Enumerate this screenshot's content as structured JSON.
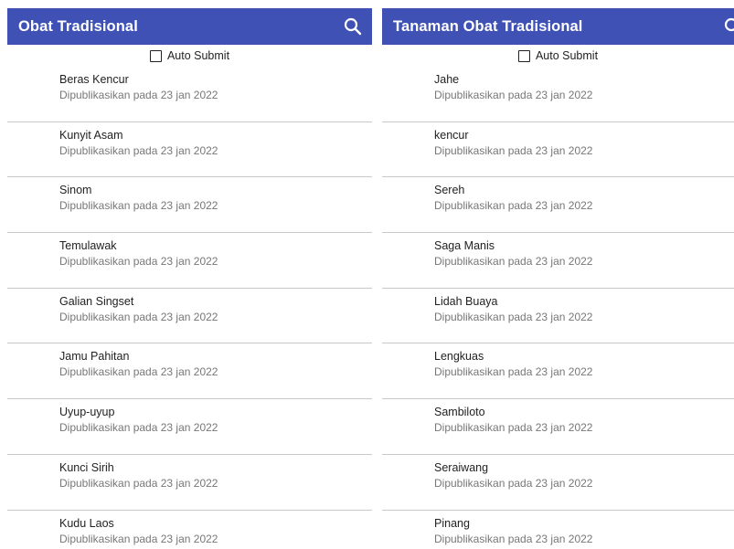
{
  "left": {
    "title": "Obat Tradisional",
    "checkbox_label": "Auto Submit",
    "items": [
      {
        "name": "Beras Kencur",
        "subtitle": "Dipublikasikan pada 23 jan 2022"
      },
      {
        "name": "Kunyit Asam",
        "subtitle": "Dipublikasikan pada 23 jan 2022"
      },
      {
        "name": "Sinom",
        "subtitle": "Dipublikasikan pada 23 jan 2022"
      },
      {
        "name": "Temulawak",
        "subtitle": "Dipublikasikan pada 23 jan 2022"
      },
      {
        "name": "Galian Singset",
        "subtitle": "Dipublikasikan pada 23 jan 2022"
      },
      {
        "name": "Jamu Pahitan",
        "subtitle": "Dipublikasikan pada 23 jan 2022"
      },
      {
        "name": "Uyup-uyup",
        "subtitle": "Dipublikasikan pada 23 jan 2022"
      },
      {
        "name": "Kunci Sirih",
        "subtitle": "Dipublikasikan pada 23 jan 2022"
      },
      {
        "name": "Kudu Laos",
        "subtitle": "Dipublikasikan pada 23 jan 2022"
      }
    ]
  },
  "right": {
    "title": "Tanaman Obat Tradisional",
    "checkbox_label": "Auto Submit",
    "items": [
      {
        "name": "Jahe",
        "subtitle": "Dipublikasikan pada 23 jan 2022"
      },
      {
        "name": "kencur",
        "subtitle": "Dipublikasikan pada 23 jan 2022"
      },
      {
        "name": "Sereh",
        "subtitle": "Dipublikasikan pada 23 jan 2022"
      },
      {
        "name": "Saga Manis",
        "subtitle": "Dipublikasikan pada 23 jan 2022"
      },
      {
        "name": "Lidah Buaya",
        "subtitle": "Dipublikasikan pada 23 jan 2022"
      },
      {
        "name": "Lengkuas",
        "subtitle": "Dipublikasikan pada 23 jan 2022"
      },
      {
        "name": "Sambiloto",
        "subtitle": "Dipublikasikan pada 23 jan 2022"
      },
      {
        "name": "Seraiwang",
        "subtitle": "Dipublikasikan pada 23 jan 2022"
      },
      {
        "name": "Pinang",
        "subtitle": "Dipublikasikan pada 23 jan 2022"
      }
    ]
  },
  "icons": {
    "search": "search-icon",
    "checkbox": "checkbox-unchecked-icon"
  },
  "colors": {
    "appbar": "#3f51b5",
    "appbar_text": "#ffffff",
    "divider": "#c8c8c8",
    "subtitle": "#777777"
  }
}
